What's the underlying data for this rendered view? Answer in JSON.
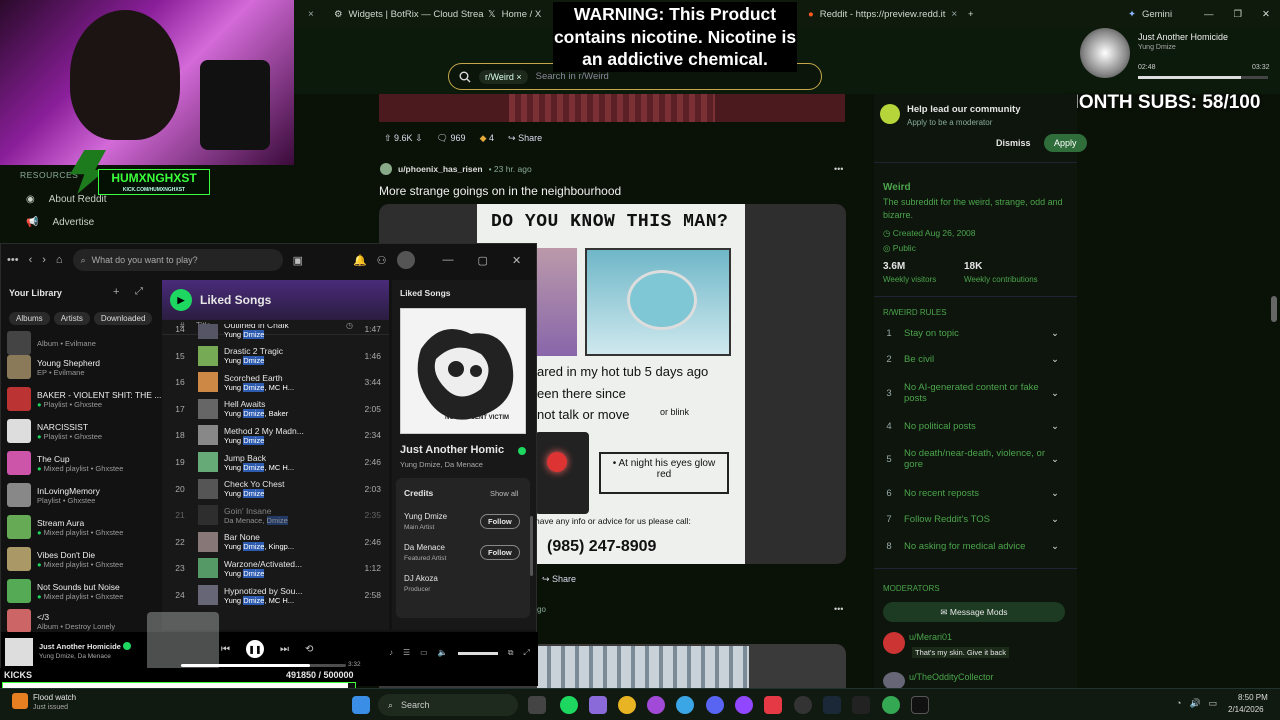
{
  "browser": {
    "tabs": [
      {
        "label": "Widgets | BotRix — Cloud Strea",
        "close": "×"
      },
      {
        "label": "Home / X",
        "close": "×"
      },
      {
        "label": "Reddit - https://preview.redd.it",
        "close": "×"
      }
    ],
    "new_tab": "+",
    "gemini": "Gemini",
    "search": {
      "chip": "r/Weird",
      "placeholder": "Search in r/Weird"
    }
  },
  "overlays": {
    "warning": "WARNING: This Product contains nicotine. Nicotine is an addictive chemical.",
    "month_subs": "MONTH SUBS: 58/100",
    "logo_text": "HUMXNGHXST",
    "logo_sub": "KICK.COM/HUMXNGHXST",
    "kicks_label": "KICKS",
    "kicks_value": "491850 / 500000",
    "flood_title": "Flood watch",
    "flood_sub": "Just issued"
  },
  "media": {
    "title": "Just Another Homicide",
    "artist": "Yung Dmize",
    "elapsed": "02:48",
    "total": "03:32"
  },
  "reddit_left": {
    "resources": "RESOURCES",
    "about": "About Reddit",
    "advertise": "Advertise"
  },
  "post_prev": {
    "upvotes": "9.6K",
    "comments": "969",
    "awards": "4",
    "share": "Share"
  },
  "post": {
    "user": "u/phoenix_has_risen",
    "time": "• 23 hr. ago",
    "title": "More strange goings on in the neighbourhood",
    "more": "•••",
    "share": "Share",
    "ago": "go",
    "poster": {
      "headline": "DO YOU KNOW THIS MAN?",
      "line1": "ared in my hot tub 5 days ago",
      "line2": "een there since",
      "line3": "not talk or move",
      "line3b": "or blink",
      "box": "• At night his eyes glow red",
      "info": "have any info or advice for us please call:",
      "phone": "(985) 247-8909"
    }
  },
  "sidebar": {
    "help_title": "Help lead our community",
    "help_sub": "Apply to be a moderator",
    "dismiss": "Dismiss",
    "apply": "Apply",
    "sub_name": "Weird",
    "sub_desc": "The subreddit for the weird, strange, odd and bizarre.",
    "created": "Created Aug 26, 2008",
    "public": "Public",
    "visitors_val": "3.6M",
    "visitors_label": "Weekly visitors",
    "contrib_val": "18K",
    "contrib_label": "Weekly contributions",
    "rules_title": "R/WEIRD RULES",
    "rules": [
      {
        "num": "1",
        "text": "Stay on topic"
      },
      {
        "num": "2",
        "text": "Be civil"
      },
      {
        "num": "3",
        "text": "No AI-generated content or fake posts"
      },
      {
        "num": "4",
        "text": "No political posts"
      },
      {
        "num": "5",
        "text": "No death/near-death, violence, or gore"
      },
      {
        "num": "6",
        "text": "No recent reposts"
      },
      {
        "num": "7",
        "text": "Follow Reddit's TOS"
      },
      {
        "num": "8",
        "text": "No asking for medical advice"
      }
    ],
    "moderators_title": "MODERATORS",
    "message_mods": "Message Mods",
    "mods": [
      {
        "name": "u/Merari01",
        "flair": "That's my skin. Give it back"
      },
      {
        "name": "u/TheOddityCollector",
        "flair": ""
      }
    ]
  },
  "spotify": {
    "search_placeholder": "What do you want to play?",
    "library_title": "Your Library",
    "filters": [
      "Albums",
      "Artists",
      "Downloaded"
    ],
    "library": [
      {
        "title": "",
        "sub": "Album • Evilmane"
      },
      {
        "title": "Young Shepherd",
        "sub": "EP • Evilmane"
      },
      {
        "title": "BAKER - VIOLENT SHIT: THE ...",
        "sub": "Playlist • Ghxstee"
      },
      {
        "title": "NARCISSIST",
        "sub": "Playlist • Ghxstee"
      },
      {
        "title": "The Cup",
        "sub": "Mixed playlist • Ghxstee"
      },
      {
        "title": "InLovingMemory",
        "sub": "Playlist • Ghxstee"
      },
      {
        "title": "Stream Aura",
        "sub": "Mixed playlist • Ghxstee"
      },
      {
        "title": "Vibes Don't Die",
        "sub": "Mixed playlist • Ghxstee"
      },
      {
        "title": "Not Sounds but Noise",
        "sub": "Mixed playlist • Ghxstee"
      },
      {
        "title": "</3",
        "sub": "Album • Destroy Lonely"
      }
    ],
    "playlist_title": "Liked Songs",
    "col_num": "#",
    "col_title": "Title",
    "tracks": [
      {
        "n": "14",
        "title": "Outlined in Chalk",
        "artist_pre": "Yung ",
        "artist_hl": "Dmize",
        "artist_post": "",
        "dur": "1:47"
      },
      {
        "n": "15",
        "title": "Drastic 2 Tragic",
        "artist_pre": "Yung ",
        "artist_hl": "Dmize",
        "artist_post": "",
        "dur": "1:46"
      },
      {
        "n": "16",
        "title": "Scorched Earth",
        "artist_pre": "Yung ",
        "artist_hl": "Dmize",
        "artist_post": ", MC H...",
        "dur": "3:44"
      },
      {
        "n": "17",
        "title": "Hell Awaits",
        "artist_pre": "Yung ",
        "artist_hl": "Dmize",
        "artist_post": ", Baker",
        "dur": "2:05"
      },
      {
        "n": "18",
        "title": "Method 2 My Madn...",
        "artist_pre": "Yung ",
        "artist_hl": "Dmize",
        "artist_post": "",
        "dur": "2:34"
      },
      {
        "n": "19",
        "title": "Jump Back",
        "artist_pre": "Yung ",
        "artist_hl": "Dmize",
        "artist_post": ", MC H...",
        "dur": "2:46"
      },
      {
        "n": "20",
        "title": "Check Yo Chest",
        "artist_pre": "Yung ",
        "artist_hl": "Dmize",
        "artist_post": "",
        "dur": "2:03"
      },
      {
        "n": "21",
        "title": "Goin' Insane",
        "artist_pre": "Da Menace, ",
        "artist_hl": "Dmize",
        "artist_post": "",
        "dur": "2:35"
      },
      {
        "n": "22",
        "title": "Bar None",
        "artist_pre": "Yung ",
        "artist_hl": "Dmize",
        "artist_post": ", Kingp...",
        "dur": "2:46"
      },
      {
        "n": "23",
        "title": "Warzone/Activated...",
        "artist_pre": "Yung ",
        "artist_hl": "Dmize",
        "artist_post": "",
        "dur": "1:12"
      },
      {
        "n": "24",
        "title": "Hypnotized by Sou...",
        "artist_pre": "Yung ",
        "artist_hl": "Dmize",
        "artist_post": ", MC H...",
        "dur": "2:58"
      }
    ],
    "right_title": "Liked Songs",
    "now_title": "Just Another Homic",
    "now_artists": "Yung Dmize, Da Menace",
    "cover_text": "NO INNOCENT VICTIM",
    "credits_title": "Credits",
    "show_all": "Show all",
    "credits": [
      {
        "name": "Yung Dmize",
        "role": "Main Artist",
        "follow": "Follow"
      },
      {
        "name": "Da Menace",
        "role": "Featured Artist",
        "follow": "Follow"
      },
      {
        "name": "DJ Akoza",
        "role": "Producer",
        "follow": ""
      }
    ],
    "player": {
      "title": "Just Another Homicide",
      "artists": "Yung Dmize, Da Menace",
      "progress": 0.78,
      "total": "3:32"
    }
  },
  "taskbar": {
    "search": "Search",
    "time": "8:50 PM",
    "date": "2/14/2026"
  }
}
